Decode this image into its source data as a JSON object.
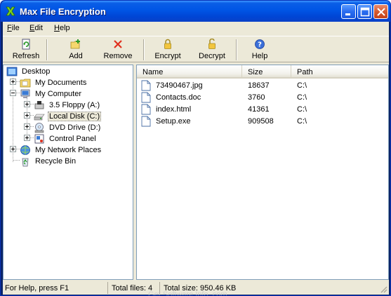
{
  "window": {
    "title": "Max File Encryption"
  },
  "menu": [
    {
      "label": "File",
      "hot": "F",
      "rest": "ile"
    },
    {
      "label": "Edit",
      "hot": "E",
      "rest": "dit"
    },
    {
      "label": "Help",
      "hot": "H",
      "rest": "elp"
    }
  ],
  "toolbar": {
    "refresh": "Refresh",
    "add": "Add",
    "remove": "Remove",
    "encrypt": "Encrypt",
    "decrypt": "Decrypt",
    "help": "Help"
  },
  "tree": {
    "desktop": "Desktop",
    "my_documents": "My Documents",
    "my_computer": "My Computer",
    "floppy": "3.5 Floppy (A:)",
    "local_disk": "Local Disk (C:)",
    "dvd": "DVD Drive (D:)",
    "control_panel": "Control Panel",
    "network": "My Network Places",
    "recycle": "Recycle Bin"
  },
  "list": {
    "columns": {
      "name": "Name",
      "size": "Size",
      "path": "Path"
    },
    "rows": [
      {
        "name": "73490467.jpg",
        "size": "18637",
        "path": "C:\\"
      },
      {
        "name": "Contacts.doc",
        "size": "3760",
        "path": "C:\\"
      },
      {
        "name": "index.html",
        "size": "41361",
        "path": "C:\\"
      },
      {
        "name": "Setup.exe",
        "size": "909508",
        "path": "C:\\"
      }
    ]
  },
  "status": {
    "help": "For Help, press F1",
    "total_files": "Total files: 4",
    "total_size": "Total size: 950.46 KB"
  },
  "watermark": "Get Software Info .com",
  "colors": {
    "titlebar": "#0055e5",
    "chrome": "#ece9d8",
    "pane_border": "#7f9db9"
  }
}
